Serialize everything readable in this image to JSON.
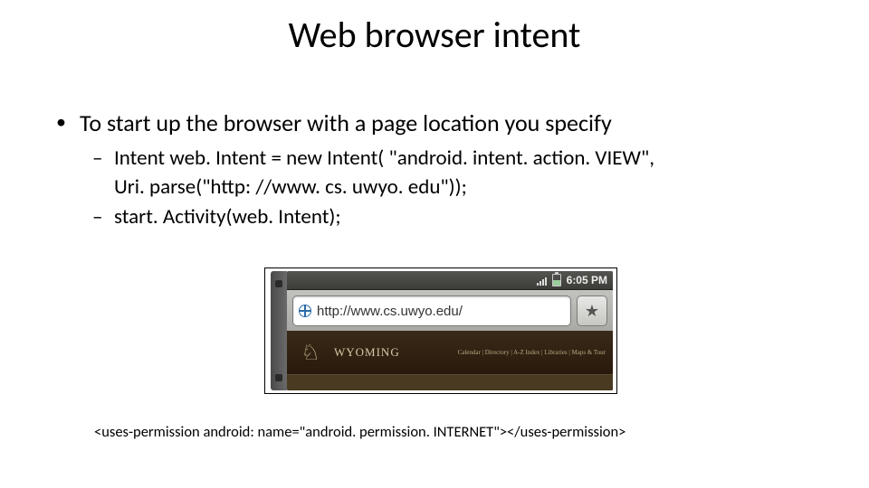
{
  "title": "Web browser intent",
  "bullets": {
    "l1": "To start up the browser with a page location you specify",
    "l2a": "Intent web. Intent = new Intent( \"android. intent. action. VIEW\",",
    "l2a_cont": "Uri. parse(\"http: //www. cs. uwyo. edu\"));",
    "l2b": "start. Activity(web. Intent);"
  },
  "phone": {
    "time": "6:05 PM",
    "url": "http://www.cs.uwyo.edu/",
    "star": "★",
    "banner_text": "WYOMING",
    "banner_logo": "♘",
    "banner_links": "Calendar | Directory | A-Z Index | Libraries | Maps & Tour"
  },
  "permission_line": "<uses-permission android: name=\"android. permission. INTERNET\"></uses-permission>"
}
